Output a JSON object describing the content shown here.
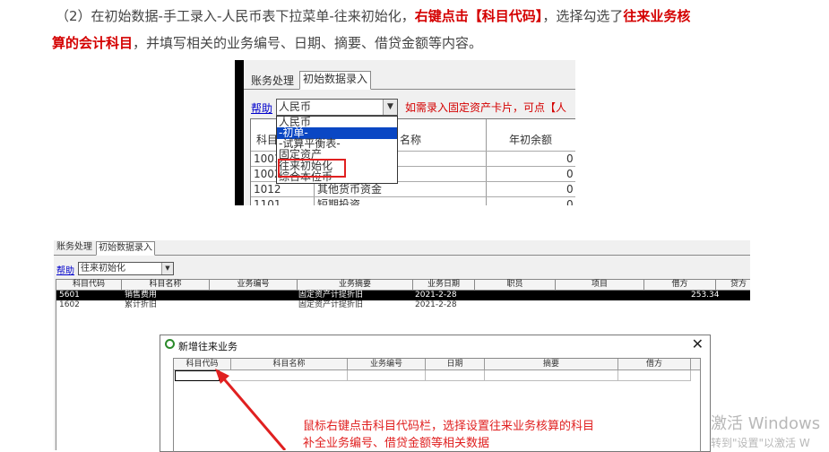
{
  "instruction": {
    "line1_a": "（2）在初始数据-手工录入-人民币表下拉菜单-往来初始化，",
    "line1_b": "右键点击【科目代码】",
    "line1_c": "，选择勾选了",
    "line1_d": "往来业务核",
    "line2_a": "算的会计科目",
    "line2_b": "，并填写相关的业务编号、日期、摘要、借贷金额等内容。"
  },
  "shot1": {
    "tabs": [
      "账务处理",
      "初始数据录入"
    ],
    "help": "帮助",
    "currency_value": "人民币",
    "hint": "如需录入固定资产卡片，可点【人",
    "grid_headers": [
      "科目",
      "名称",
      "年初余额"
    ],
    "dropdown": [
      "人民币",
      "-初单-",
      "-试算平衡表-",
      "固定资产",
      "往来初始化",
      "综合本位币"
    ],
    "rows": [
      {
        "code": "1001",
        "name": "",
        "val": "0"
      },
      {
        "code": "1002",
        "name": "",
        "val": "0"
      },
      {
        "code": "1012",
        "name": "其他货币资金",
        "val": "0"
      },
      {
        "code": "1101",
        "name": "短期投资",
        "val": "0"
      }
    ]
  },
  "shot2": {
    "tabs": [
      "账务处理",
      "初始数据录入"
    ],
    "help": "帮助",
    "combo_value": "往来初始化",
    "headers": [
      "科目代码",
      "科目名称",
      "业务编号",
      "业务摘要",
      "业务日期",
      "职员",
      "项目",
      "借方",
      "贷方"
    ],
    "rows": [
      {
        "code": "5601",
        "name": "销售费用",
        "no": "",
        "summary": "固定资产计提折旧",
        "date": "2021-2-28",
        "debit": "253.34"
      },
      {
        "code": "1602",
        "name": "累计折旧",
        "no": "",
        "summary": "固定资产计提折旧",
        "date": "2021-2-28",
        "debit": ""
      }
    ]
  },
  "dialog": {
    "title": "新增往来业务",
    "close": "✕",
    "headers": [
      "科目代码",
      "科目名称",
      "业务编号",
      "日期",
      "摘要",
      "借方"
    ],
    "note_line1": "鼠标右键点击科目代码栏，选择设置往来业务核算的科目",
    "note_line2": "补全业务编号、借贷金额等相关数据"
  },
  "watermark": {
    "line1": "激活 Windows",
    "line2": "转到\"设置\"以激活 W"
  },
  "colors": {
    "accent_red": "#d40000",
    "selection_blue": "#0a47c4"
  }
}
